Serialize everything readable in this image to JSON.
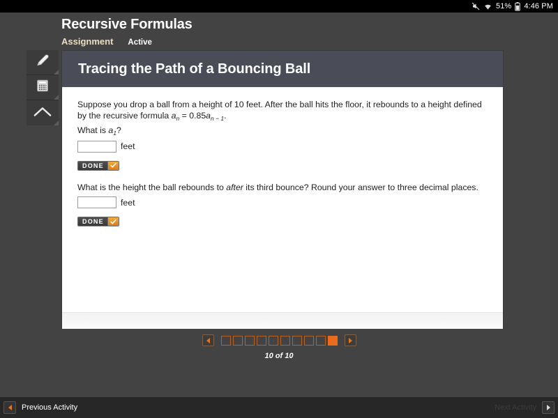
{
  "statusbar": {
    "mute_icon": "mute-icon",
    "wifi_icon": "wifi-icon",
    "battery_percent": "51%",
    "battery_icon": "battery-icon",
    "time": "4:46 PM"
  },
  "header": {
    "title": "Recursive Formulas",
    "assignment_label": "Assignment",
    "status_label": "Active"
  },
  "toolrail": {
    "items": [
      {
        "name": "pencil-icon",
        "label": "Highlighter"
      },
      {
        "name": "calculator-icon",
        "label": "Calculator"
      },
      {
        "name": "chevron-up-icon",
        "label": "Collapse"
      }
    ]
  },
  "card": {
    "title": "Tracing the Path of a Bouncing Ball",
    "questions": [
      {
        "intro_part1": "Suppose you drop a ball from a height of 10 feet. After the ball hits the floor, it rebounds to a height defined by the recursive formula ",
        "formula_a": "a",
        "formula_sub_n": "n",
        "formula_eq": " = 0.85",
        "formula_a2": "a",
        "formula_sub_n1": "n − 1",
        "formula_end": ".",
        "prompt_pre": "What is ",
        "prompt_var": "a",
        "prompt_sub": "1",
        "prompt_post": "?",
        "answer_value": "",
        "answer_placeholder": "",
        "unit": "feet",
        "done_label": "DONE",
        "check_icon": "check-icon"
      },
      {
        "prompt_pre": "What is the height the ball rebounds to ",
        "prompt_em": "after",
        "prompt_post": " its third bounce? Round your answer to three decimal places.",
        "answer_value": "",
        "answer_placeholder": "",
        "unit": "feet",
        "done_label": "DONE",
        "check_icon": "check-icon"
      }
    ]
  },
  "pager": {
    "prev_icon": "arrow-left-icon",
    "next_icon": "arrow-right-icon",
    "total_steps": 10,
    "current_step": 10,
    "count_label": "10 of 10"
  },
  "activitybar": {
    "prev_label": "Previous Activity",
    "next_label": "Next Activity",
    "prev_icon": "arrow-left-icon",
    "next_icon": "arrow-right-icon",
    "prev_enabled": true,
    "next_enabled": false
  },
  "colors": {
    "accent_orange": "#eb6b1d",
    "app_background": "#434343",
    "card_header": "#4a4d58",
    "assignment_tan": "#e8dfc0"
  }
}
